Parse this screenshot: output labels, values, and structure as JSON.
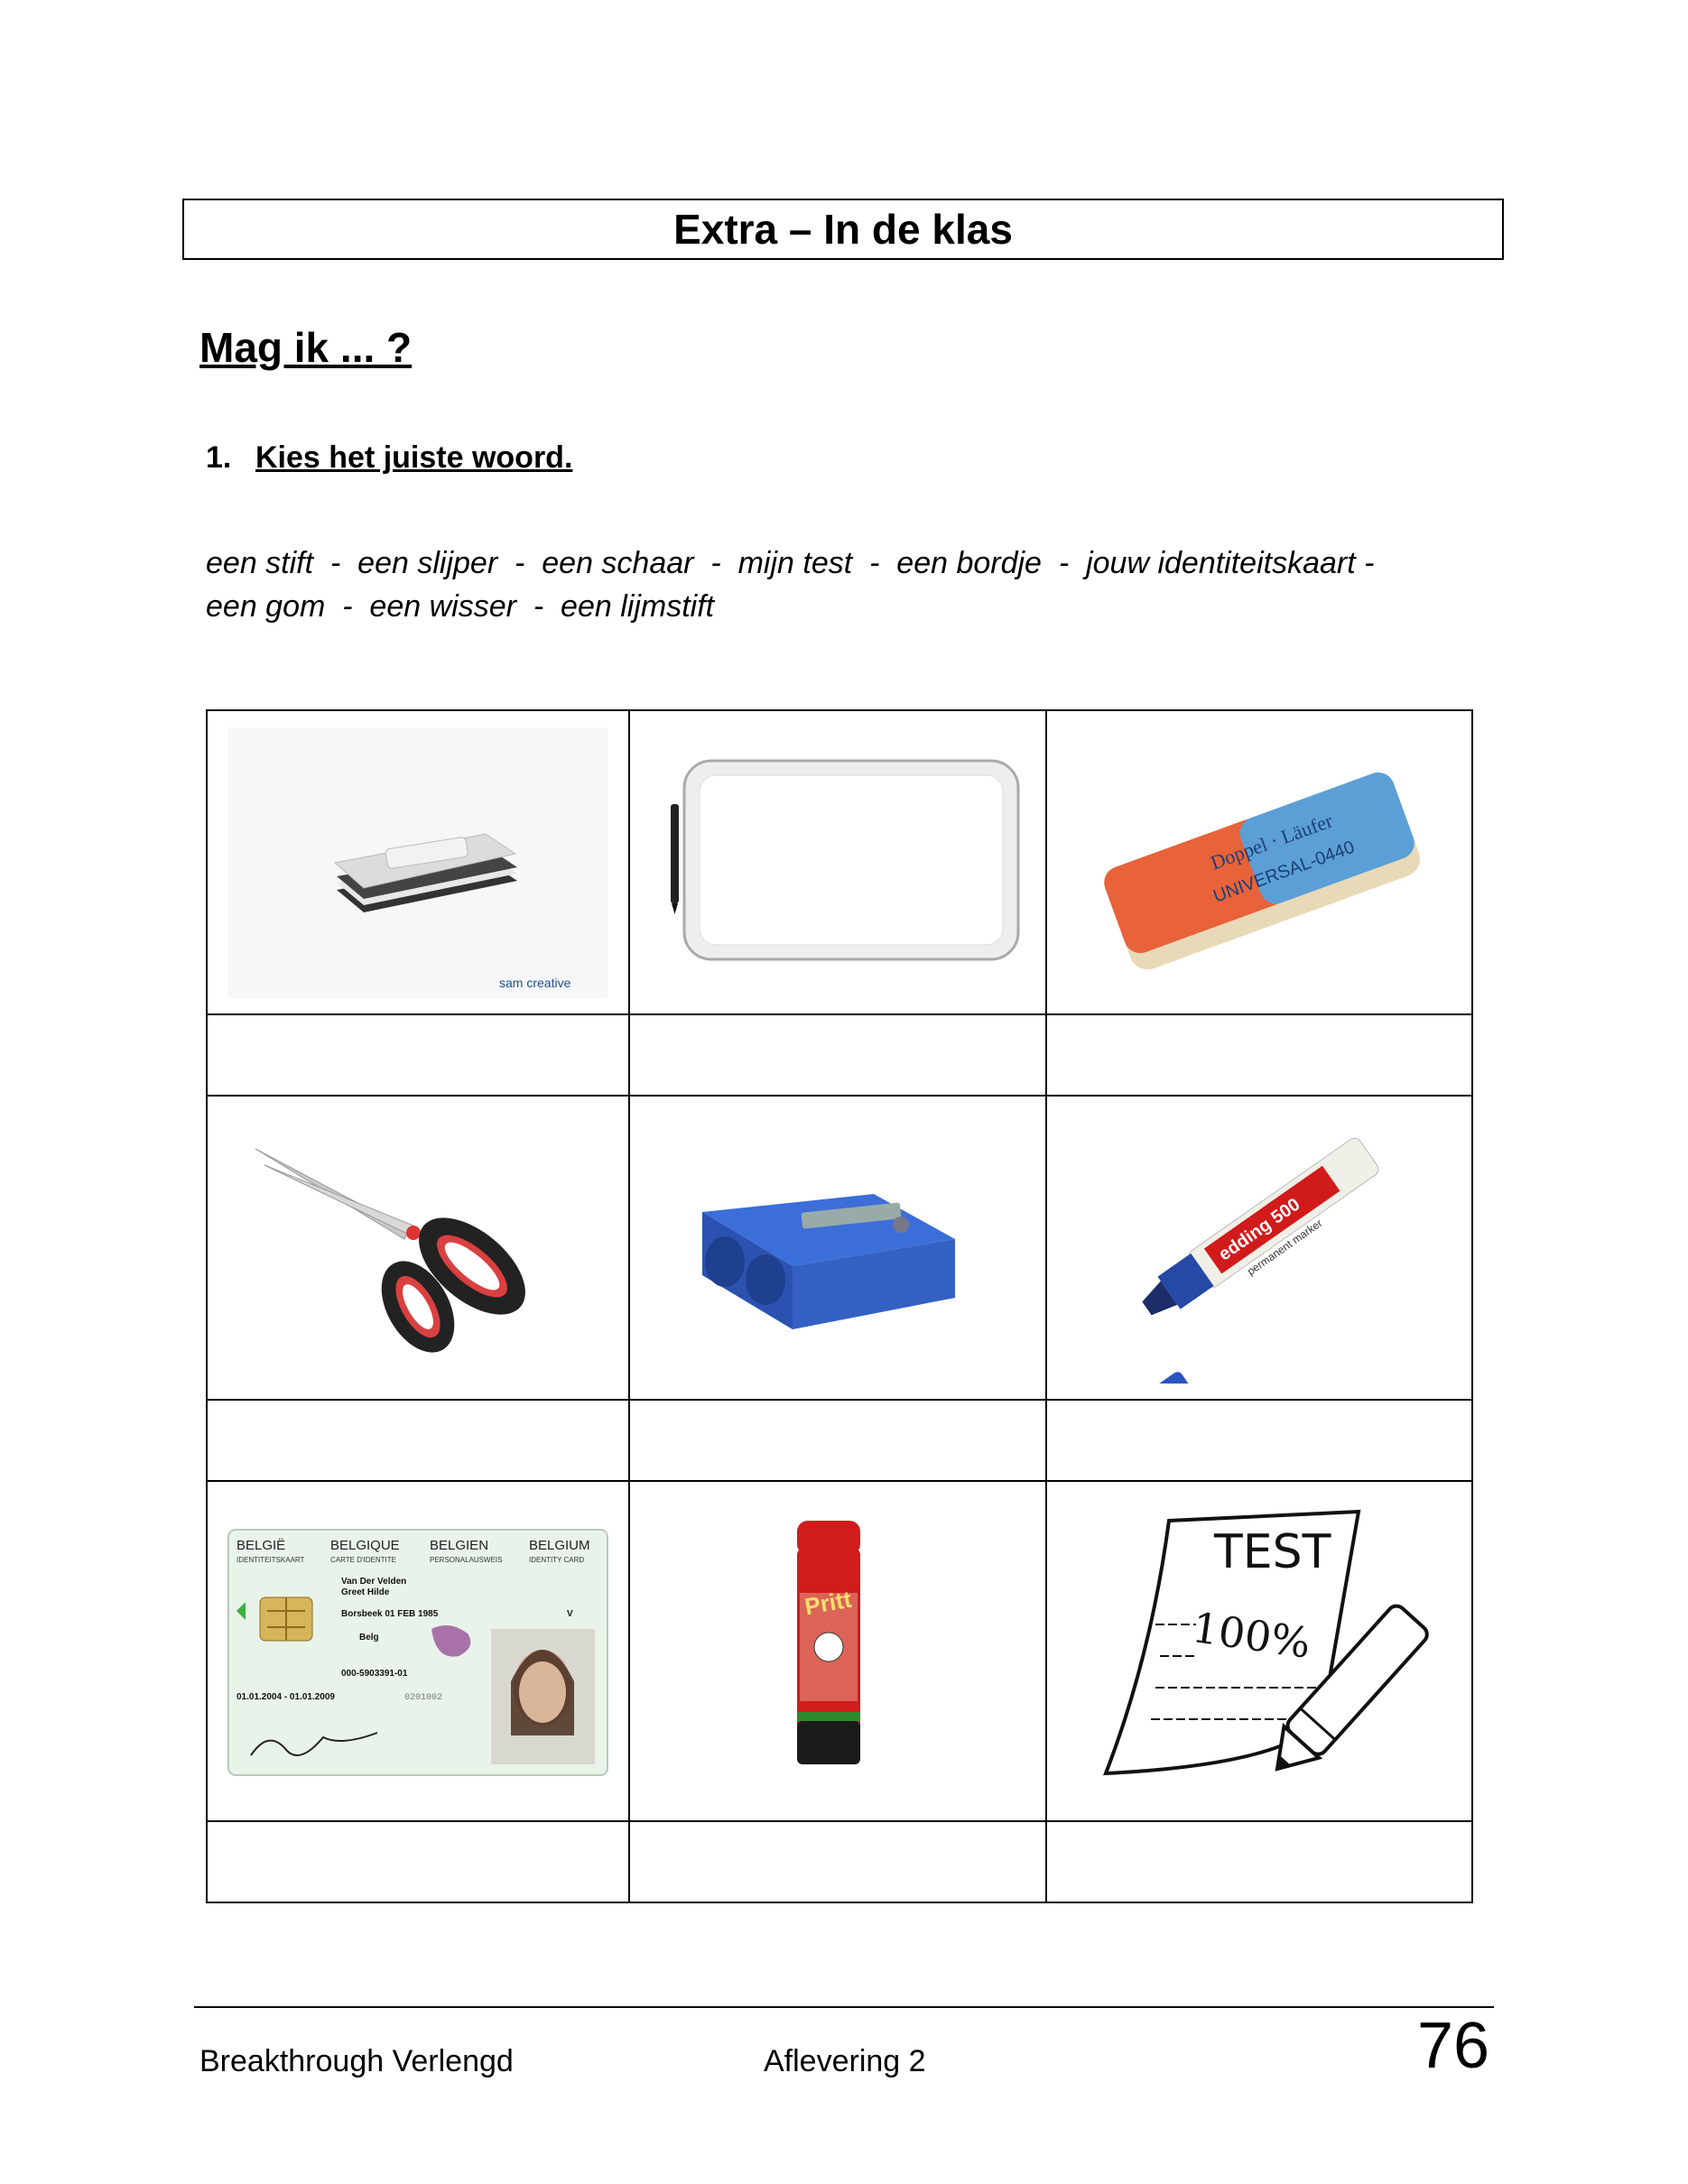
{
  "header": {
    "title": "Extra – In de klas"
  },
  "section": {
    "title": "Mag ik ... ?"
  },
  "exercise": {
    "number": "1.",
    "instruction": "Kies het juiste woord."
  },
  "wordbank": {
    "line1": "een stift  -  een slijper  -  een schaar  -  mijn test  -  een bordje  -  jouw identiteitskaart -",
    "line2": "een gom  -  een wisser  -  een lijmstift"
  },
  "pictures": {
    "wisser_logo": "sam creative",
    "gum_text_top": "Doppel · Läufer",
    "gum_text_bottom": "UNIVERSAL-0440",
    "marker_text": "edding 500",
    "marker_subtext": "permanent marker",
    "id_card": {
      "countries": [
        "BELGIË",
        "BELGIQUE",
        "BELGIEN",
        "BELGIUM"
      ],
      "subtitles": [
        "IDENTITEITSKAART",
        "CARTE D'IDENTITE",
        "PERSONALAUSWEIS",
        "IDENTITY CARD"
      ],
      "name": "Van Der Velden",
      "given": "Greet Hilde",
      "birth": "Borsbeek  01 FEB 1985",
      "sex": "V",
      "nationality": "Belg",
      "card_no": "000-5903391-01",
      "valid": "01.01.2004 - 01.01.2009",
      "serial": "0201002"
    },
    "glue_brand": "Pritt",
    "test_label": "TEST",
    "test_score": "100%"
  },
  "footer": {
    "left": "Breakthrough Verlengd",
    "middle": "Aflevering 2",
    "page": "76"
  }
}
